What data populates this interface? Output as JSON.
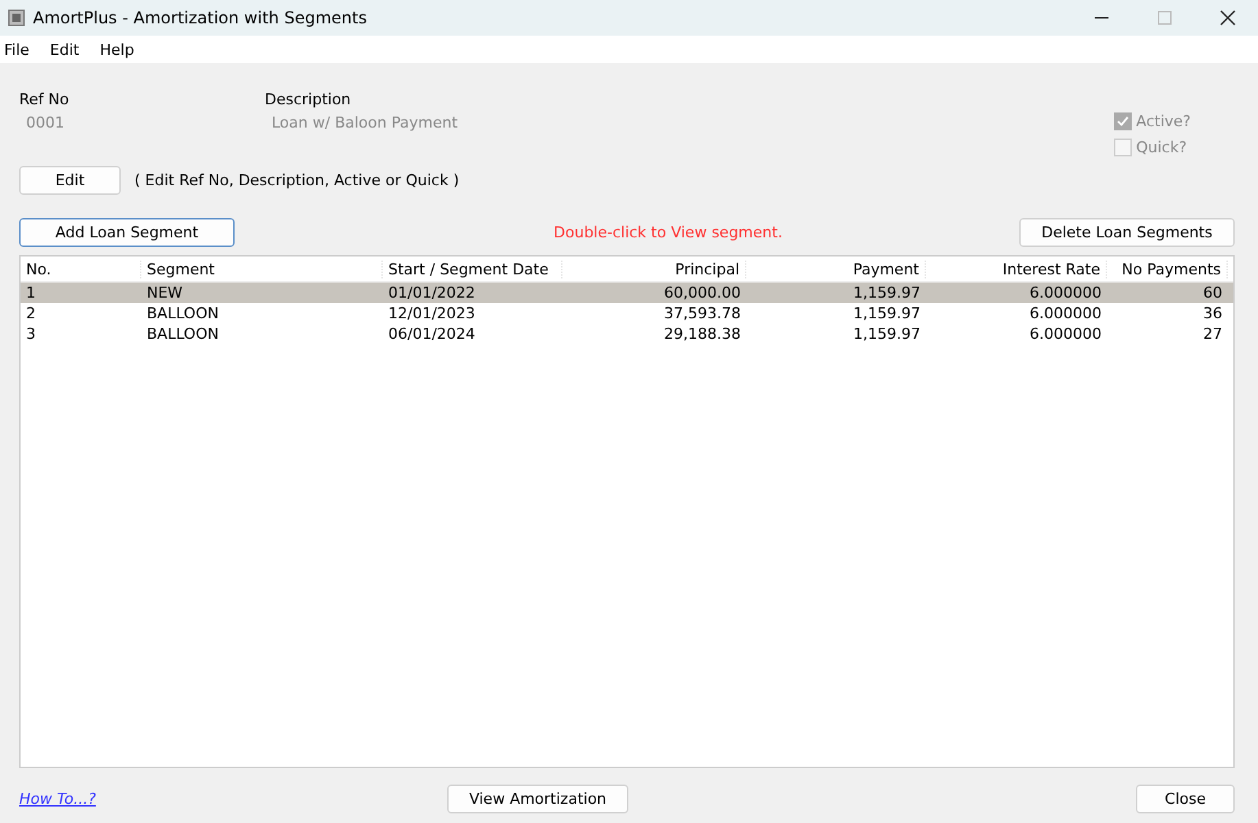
{
  "window": {
    "title": "AmortPlus - Amortization with Segments"
  },
  "menu": [
    "File",
    "Edit",
    "Help"
  ],
  "fields": [
    {
      "label": "Ref No",
      "value": "0001",
      "disabled": true
    },
    {
      "label": "Description",
      "value": "Loan w/ Baloon Payment",
      "disabled": true
    }
  ],
  "checkboxes": [
    {
      "label": "Active?",
      "checked": true,
      "disabled": true
    },
    {
      "label": "Quick?",
      "checked": false,
      "disabled": true
    }
  ],
  "edit_button": "Edit",
  "edit_hint": "( Edit Ref No, Description, Active or Quick )",
  "add_button": "Add Loan Segment",
  "notice": "Double-click to View segment.",
  "delete_button": "Delete Loan Segments",
  "table": {
    "columns": [
      "No.",
      "Segment",
      "Start / Segment Date",
      "Principal",
      "Payment",
      "Interest Rate",
      "No Payments"
    ],
    "rows": [
      {
        "cells": [
          "1",
          "NEW",
          "01/01/2022",
          "60,000.00",
          "1,159.97",
          "6.000000",
          "60"
        ],
        "selected": true
      },
      {
        "cells": [
          "2",
          "BALLOON",
          "12/01/2023",
          "37,593.78",
          "1,159.97",
          "6.000000",
          "36"
        ],
        "selected": false
      },
      {
        "cells": [
          "3",
          "BALLOON",
          "06/01/2024",
          "29,188.38",
          "1,159.97",
          "6.000000",
          "27"
        ],
        "selected": false
      }
    ]
  },
  "footer": {
    "link": "How To...?",
    "view_button": "View Amortization",
    "close_button": "Close"
  }
}
